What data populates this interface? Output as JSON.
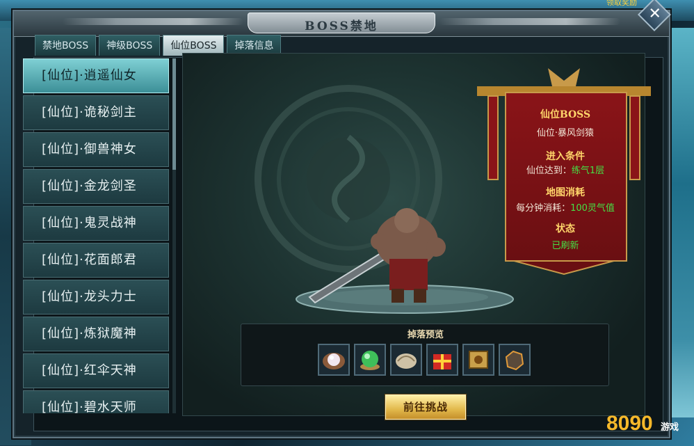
{
  "window": {
    "title": "BOSS禁地",
    "close_label": "✕"
  },
  "tabs": [
    {
      "label": "禁地BOSS",
      "active": false
    },
    {
      "label": "神级BOSS",
      "active": false
    },
    {
      "label": "仙位BOSS",
      "active": true
    },
    {
      "label": "掉落信息",
      "active": false
    }
  ],
  "boss_list": [
    {
      "label": "[仙位]·逍遥仙女",
      "selected": true
    },
    {
      "label": "[仙位]·诡秘剑主",
      "selected": false
    },
    {
      "label": "[仙位]·御兽神女",
      "selected": false
    },
    {
      "label": "[仙位]·金龙剑圣",
      "selected": false
    },
    {
      "label": "[仙位]·鬼灵战神",
      "selected": false
    },
    {
      "label": "[仙位]·花面郎君",
      "selected": false
    },
    {
      "label": "[仙位]·龙头力士",
      "selected": false
    },
    {
      "label": "[仙位]·炼狱魔神",
      "selected": false
    },
    {
      "label": "[仙位]·红伞天神",
      "selected": false
    },
    {
      "label": "[仙位]·碧水天师",
      "selected": false
    }
  ],
  "info": {
    "header": "仙位BOSS",
    "boss_name": "仙位·暴风剑猿",
    "entry_title": "进入条件",
    "entry_label": "仙位达到：",
    "entry_value": "练气1层",
    "cost_title": "地图消耗",
    "cost_label": "每分钟消耗：",
    "cost_value": "100灵气值",
    "status_title": "状态",
    "status_value": "已刷新"
  },
  "drop_preview": {
    "title": "掉落预览",
    "items": [
      "pearl-icon",
      "jade-orb-icon",
      "shell-icon",
      "gift-box-icon",
      "scroll-icon",
      "ore-icon"
    ]
  },
  "go_button": "前往挑战",
  "corner_text": "领取奖励",
  "watermark": {
    "brand": "8090",
    "sub": "游戏"
  },
  "colors": {
    "accent_gold": "#e2b94c",
    "banner_red": "#8a1418",
    "status_green": "#45e045",
    "tab_active": "#e4eef0",
    "list_selected": "#7fd0d4"
  }
}
